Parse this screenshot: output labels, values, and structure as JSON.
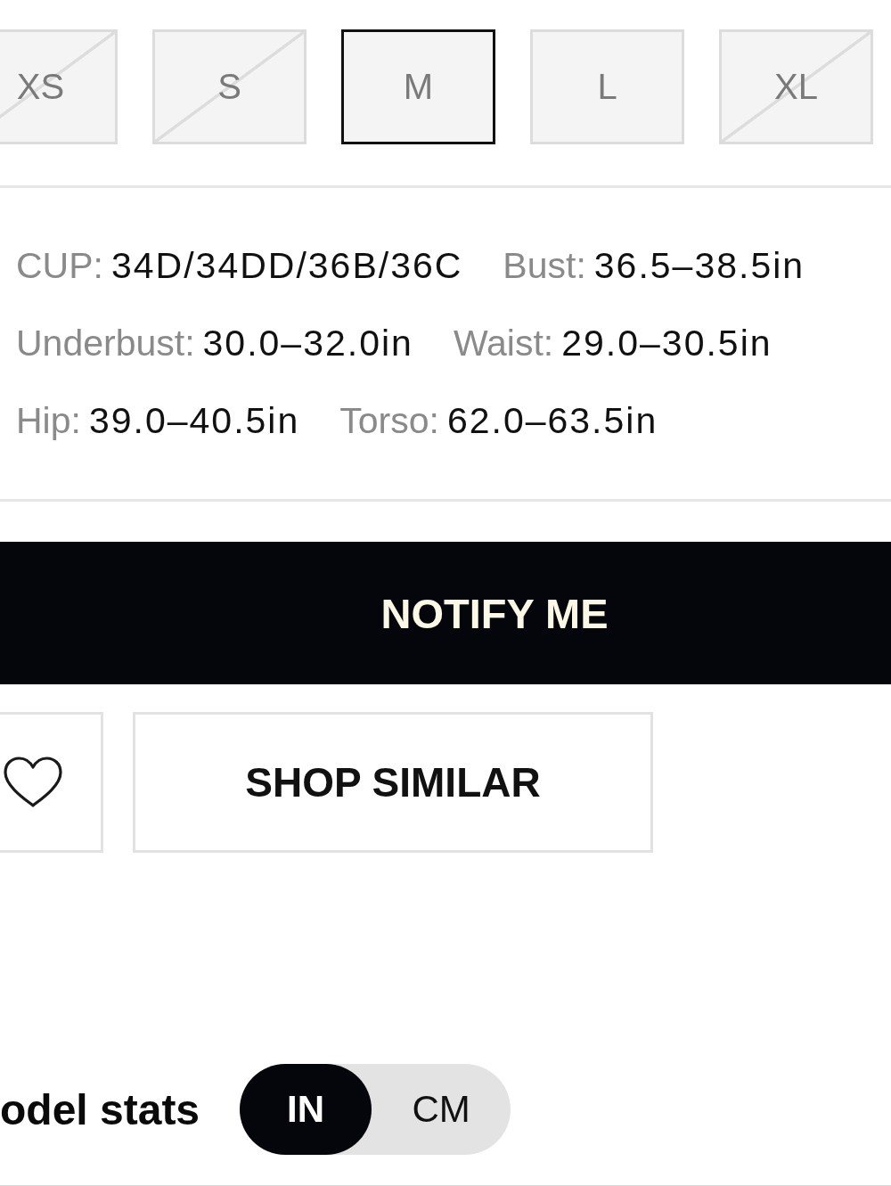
{
  "sizes": [
    {
      "label": "XS",
      "selected": false,
      "available": false
    },
    {
      "label": "S",
      "selected": false,
      "available": false
    },
    {
      "label": "M",
      "selected": true,
      "available": true
    },
    {
      "label": "L",
      "selected": false,
      "available": true
    },
    {
      "label": "XL",
      "selected": false,
      "available": false
    }
  ],
  "measurement_rows": [
    {
      "items": [
        {
          "label": "CUP:",
          "value": "34D/34DD/36B/36C"
        },
        {
          "label": "Bust:",
          "value": "36.5–38.5in"
        }
      ]
    },
    {
      "items": [
        {
          "label": "Underbust:",
          "value": "30.0–32.0in"
        },
        {
          "label": "Waist:",
          "value": "29.0–30.5in"
        }
      ]
    },
    {
      "items": [
        {
          "label": "Hip:",
          "value": "39.0–40.5in"
        },
        {
          "label": "Torso:",
          "value": "62.0–63.5in"
        }
      ]
    }
  ],
  "notify_button": {
    "label": "NOTIFY ME"
  },
  "shop_similar_button": {
    "label": "SHOP SIMILAR"
  },
  "model_stats": {
    "label": "odel stats",
    "units": [
      {
        "label": "IN",
        "selected": true
      },
      {
        "label": "CM",
        "selected": false
      }
    ]
  }
}
